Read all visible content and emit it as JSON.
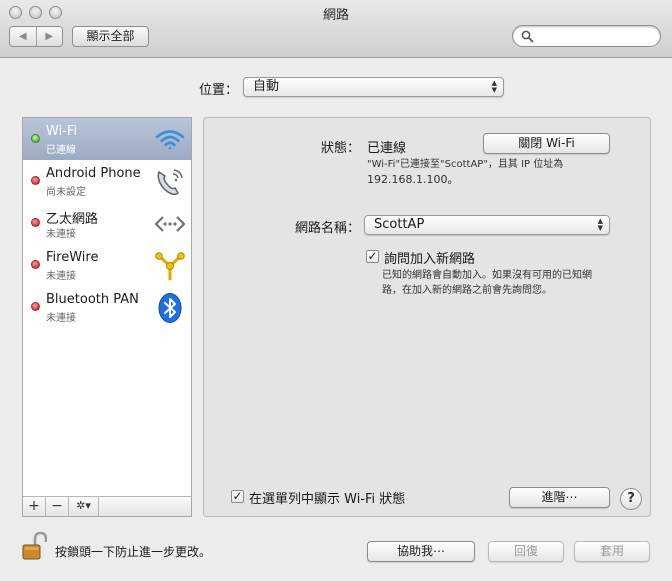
{
  "window": {
    "title": "網路"
  },
  "toolbar": {
    "back_label": "◀",
    "forward_label": "▶",
    "show_all_label": "顯示全部",
    "search_placeholder": ""
  },
  "location": {
    "label": "位置：",
    "value": "自動"
  },
  "services": [
    {
      "name": "Wi-Fi",
      "status": "已連線",
      "state": "connected",
      "icon": "wifi-icon",
      "selected": true
    },
    {
      "name": "Android Phone",
      "status": "尚未設定",
      "state": "inactive",
      "icon": "phone-icon"
    },
    {
      "name": "乙太網路",
      "status": "未連接",
      "state": "inactive",
      "icon": "ethernet-icon"
    },
    {
      "name": "FireWire",
      "status": "未連接",
      "state": "inactive",
      "icon": "firewire-icon"
    },
    {
      "name": "Bluetooth PAN",
      "status": "未連接",
      "state": "inactive",
      "icon": "bluetooth-icon"
    }
  ],
  "sidebar_actions": {
    "add": "+",
    "remove": "−",
    "gear": "✲▾"
  },
  "detail": {
    "status_label": "狀態：",
    "status_value": "已連線",
    "turn_off_button": "關閉 Wi-Fi",
    "status_desc_line1": "\"Wi-Fi\"已連接至\"ScottAP\"，且其 IP 位址為",
    "status_desc_line2": "192.168.1.100。",
    "network_name_label": "網路名稱：",
    "network_name_value": "ScottAP",
    "ask_join_label": "詢問加入新網路",
    "ask_join_checked": true,
    "ask_join_desc_line1": "已知的網路會自動加入。如果沒有可用的已知網",
    "ask_join_desc_line2": "路，在加入新的網路之前會先詢問您。",
    "show_menu_label": "在選單列中顯示 Wi-Fi 狀態",
    "show_menu_checked": true,
    "advanced_button": "進階⋯",
    "help_label": "?"
  },
  "footer": {
    "lock_text": "按鎖頭一下防止進一步更改。",
    "assist_button": "協助我⋯",
    "revert_button": "回復",
    "apply_button": "套用"
  },
  "colors": {
    "selection": "#9daac3",
    "connected": "#3aa51b",
    "disconnected": "#c8101b",
    "wifi": "#3b8fd9",
    "bluetooth": "#1f6fe0"
  }
}
